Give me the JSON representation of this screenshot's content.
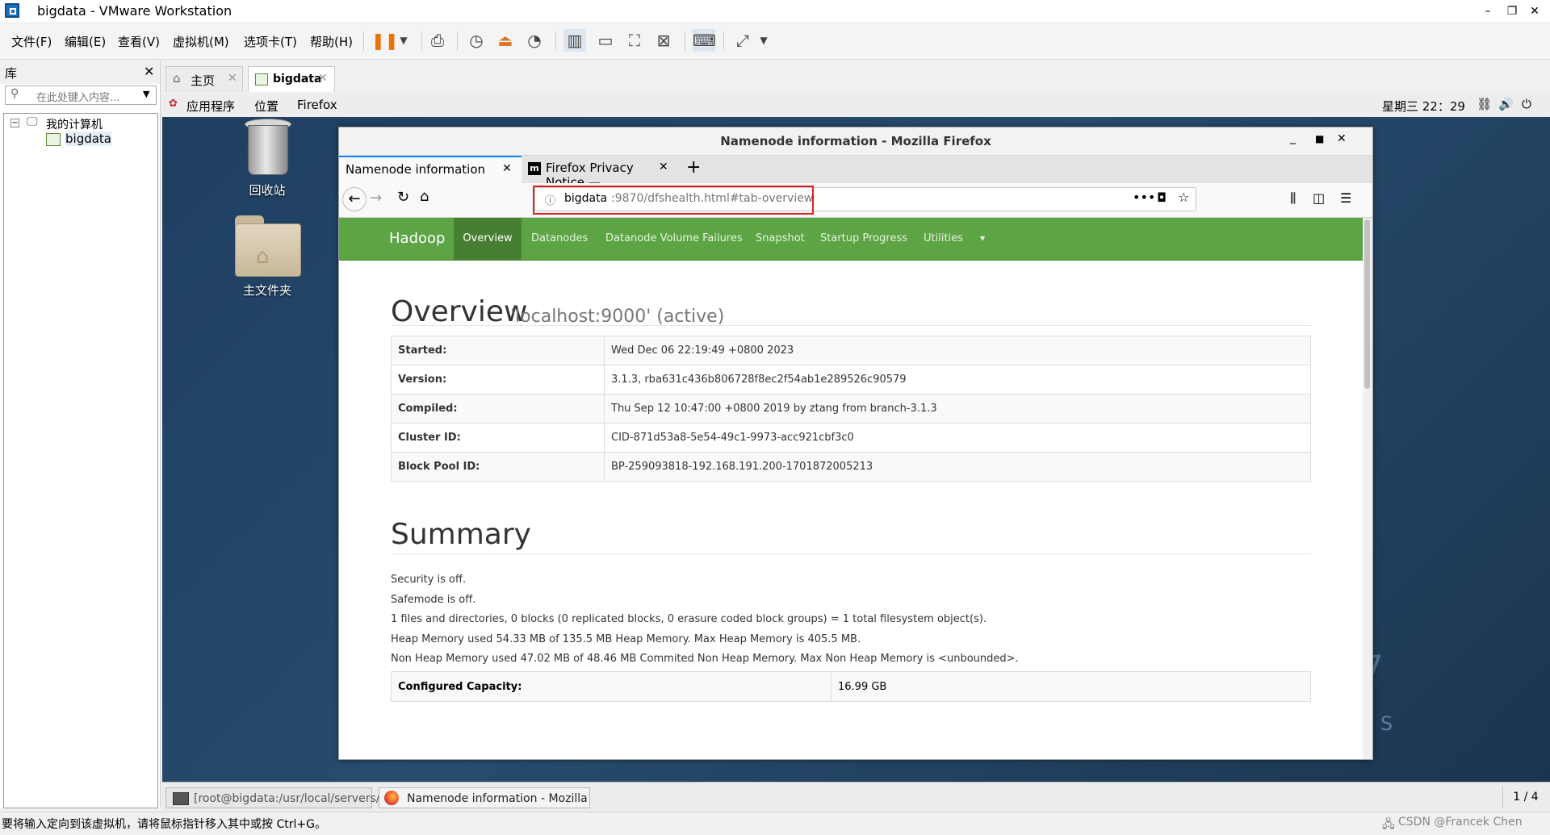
{
  "window": {
    "title": "bigdata - VMware Workstation"
  },
  "menu": [
    "文件(F)",
    "编辑(E)",
    "查看(V)",
    "虚拟机(M)",
    "选项卡(T)",
    "帮助(H)"
  ],
  "library": {
    "title": "库",
    "search_placeholder": "在此处键入内容...",
    "tree": {
      "root": "我的计算机",
      "child": "bigdata"
    }
  },
  "vm_tabs": [
    {
      "label": "主页"
    },
    {
      "label": "bigdata"
    }
  ],
  "gnome": {
    "applications": "应用程序",
    "places": "位置",
    "firefox": "Firefox",
    "clock": "星期三 22：29"
  },
  "desktop": {
    "trash": "回收站",
    "home": "主文件夹",
    "watermark_digit": "7",
    "watermark_text": "OS"
  },
  "firefox": {
    "title": "Namenode information - Mozilla Firefox",
    "tabs": [
      {
        "label": "Namenode information"
      },
      {
        "label": "Firefox Privacy Notice —"
      }
    ],
    "url_host": "bigdata",
    "url_rest": ":9870/dfshealth.html#tab-overview"
  },
  "hadoop": {
    "brand": "Hadoop",
    "nav": [
      "Overview",
      "Datanodes",
      "Datanode Volume Failures",
      "Snapshot",
      "Startup Progress",
      "Utilities"
    ],
    "overview_title": "Overview",
    "overview_sub": "'localhost:9000' (active)",
    "info": [
      {
        "k": "Started:",
        "v": "Wed Dec 06 22:19:49 +0800 2023"
      },
      {
        "k": "Version:",
        "v": "3.1.3, rba631c436b806728f8ec2f54ab1e289526c90579"
      },
      {
        "k": "Compiled:",
        "v": "Thu Sep 12 10:47:00 +0800 2019 by ztang from branch-3.1.3"
      },
      {
        "k": "Cluster ID:",
        "v": "CID-871d53a8-5e54-49c1-9973-acc921cbf3c0"
      },
      {
        "k": "Block Pool ID:",
        "v": "BP-259093818-192.168.191.200-1701872005213"
      }
    ],
    "summary_title": "Summary",
    "summary_lines": [
      "Security is off.",
      "Safemode is off.",
      "1 files and directories, 0 blocks (0 replicated blocks, 0 erasure coded block groups) = 1 total filesystem object(s).",
      "Heap Memory used 54.33 MB of 135.5 MB Heap Memory. Max Heap Memory is 405.5 MB.",
      "Non Heap Memory used 47.02 MB of 48.46 MB Commited Non Heap Memory. Max Non Heap Memory is <unbounded>."
    ],
    "capacity": {
      "k": "Configured Capacity:",
      "v": "16.99 GB"
    }
  },
  "taskbar": {
    "items": [
      "[root@bigdata:/usr/local/servers/ha···",
      "Namenode information - Mozilla Fir···"
    ],
    "workspace": "1 / 4"
  },
  "status": {
    "text": "要将输入定向到该虚拟机，请将鼠标指针移入其中或按 Ctrl+G。",
    "csdn": "CSDN @Francek Chen"
  },
  "colors": {
    "hadoop_green": "#5ca444",
    "highlight_red": "#e02020"
  }
}
